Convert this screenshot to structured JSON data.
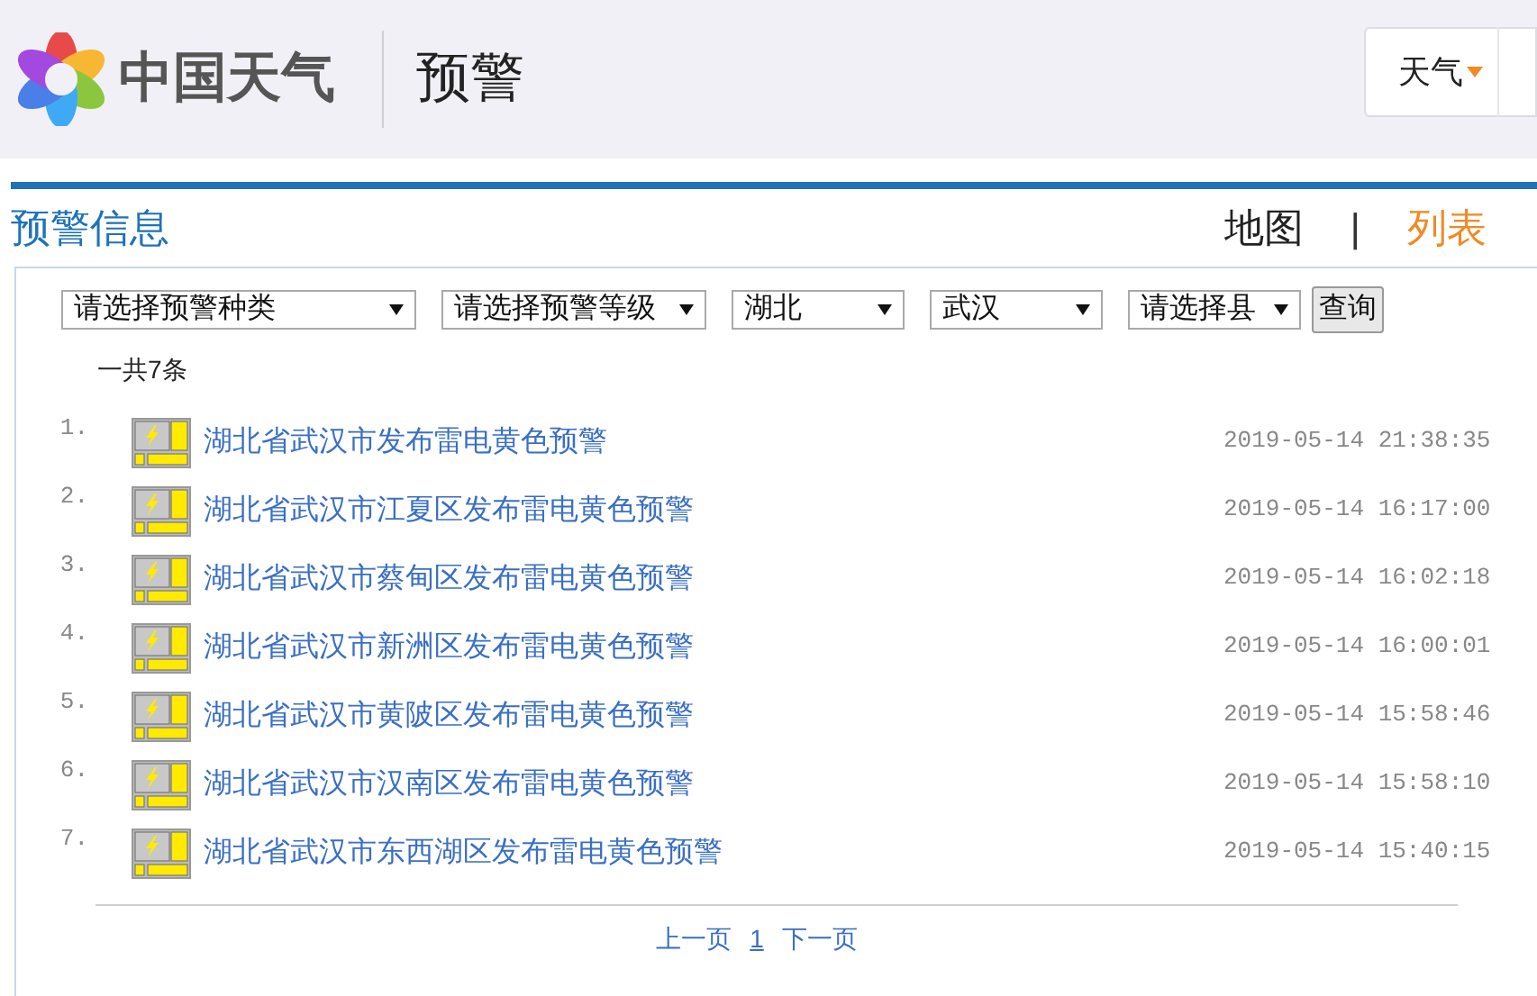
{
  "header": {
    "logo_text": "中国天气",
    "section_title": "预警",
    "nav_menu": {
      "label": "天气"
    }
  },
  "page_title": "预警信息",
  "view_tabs": [
    {
      "label": "地图",
      "selected": false
    },
    {
      "label": "列表",
      "selected": true
    }
  ],
  "tab_separator": "|",
  "filters": [
    {
      "value": "请选择预警种类"
    },
    {
      "value": "请选择预警等级"
    },
    {
      "value": "湖北"
    },
    {
      "value": "武汉"
    },
    {
      "value": "请选择县"
    }
  ],
  "query_button": "查询",
  "total_count": "一共7条",
  "alerts": [
    {
      "index": "1.",
      "title": "湖北省武汉市发布雷电黄色预警",
      "time": "2019-05-14 21:38:35"
    },
    {
      "index": "2.",
      "title": "湖北省武汉市江夏区发布雷电黄色预警",
      "time": "2019-05-14 16:17:00"
    },
    {
      "index": "3.",
      "title": "湖北省武汉市蔡甸区发布雷电黄色预警",
      "time": "2019-05-14 16:02:18"
    },
    {
      "index": "4.",
      "title": "湖北省武汉市新洲区发布雷电黄色预警",
      "time": "2019-05-14 16:00:01"
    },
    {
      "index": "5.",
      "title": "湖北省武汉市黄陂区发布雷电黄色预警",
      "time": "2019-05-14 15:58:46"
    },
    {
      "index": "6.",
      "title": "湖北省武汉市汉南区发布雷电黄色预警",
      "time": "2019-05-14 15:58:10"
    },
    {
      "index": "7.",
      "title": "湖北省武汉市东西湖区发布雷电黄色预警",
      "time": "2019-05-14 15:40:15"
    }
  ],
  "pagination": {
    "prev": "上一页",
    "pages": [
      {
        "label": "1",
        "selected": true
      }
    ],
    "next": "下一页"
  }
}
